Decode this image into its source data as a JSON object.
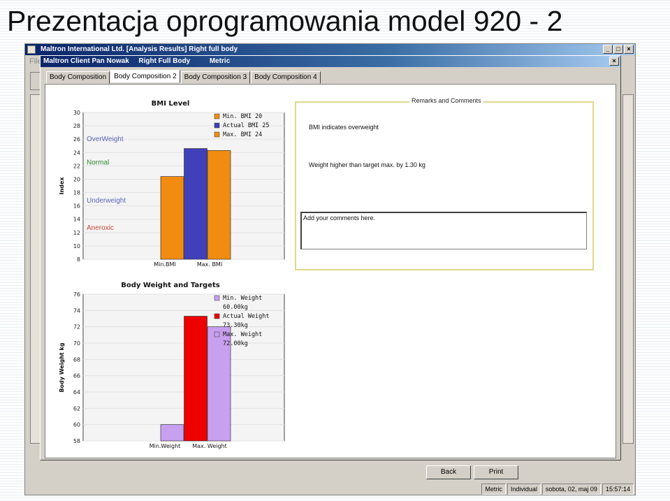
{
  "slide_title": "Prezentacja oprogramowania model 920 - 2",
  "outer_window": {
    "title": "Maltron International Ltd.  [Analysis Results]  Right full body",
    "menu_label": "File",
    "controls": [
      "_",
      "□",
      "×"
    ]
  },
  "inner_window": {
    "title_client": "Maltron Client Pan Nowak",
    "title_body": "Right Full Body",
    "title_unit": "Metric",
    "close": "×"
  },
  "tabs": [
    {
      "label": "Body Composition",
      "active": false
    },
    {
      "label": "Body Composition 2",
      "active": true
    },
    {
      "label": "Body Composition 3",
      "active": false
    },
    {
      "label": "Body Composition 4",
      "active": false
    }
  ],
  "chart_data": [
    {
      "type": "bar",
      "title": "BMI Level",
      "ylabel": "Index",
      "ylim": [
        8,
        30
      ],
      "yticks": [
        8,
        10,
        12,
        14,
        16,
        18,
        20,
        22,
        24,
        26,
        28,
        30
      ],
      "xtick_labels": [
        "Min.BMI",
        "Max. BMI"
      ],
      "bands": [
        {
          "label": "OverWeight",
          "y": 26,
          "color": "#5a66b8"
        },
        {
          "label": "Normal",
          "y": 22.5,
          "color": "#2e8a2e"
        },
        {
          "label": "Underweight",
          "y": 16.8,
          "color": "#5a66b8"
        },
        {
          "label": "Aneroxic",
          "y": 12.7,
          "color": "#cc4a3a"
        }
      ],
      "series": [
        {
          "name": "Min. BMI  20",
          "value": 20.4,
          "color": "#f28c10"
        },
        {
          "name": "Actual BMI  25",
          "value": 24.6,
          "color": "#4040bb"
        },
        {
          "name": "Max. BMI  24",
          "value": 24.3,
          "color": "#f28c10"
        }
      ]
    },
    {
      "type": "bar",
      "title": "Body Weight and Targets",
      "ylabel": "Body Weight kg",
      "ylim": [
        58,
        76
      ],
      "yticks": [
        58,
        60,
        62,
        64,
        66,
        68,
        70,
        72,
        74,
        76
      ],
      "xtick_labels": [
        "Min.Weight",
        "Max. Weight"
      ],
      "series": [
        {
          "name": "Min. Weight",
          "value_label": "60.00kg",
          "value": 60.0,
          "color": "#c8a0f0"
        },
        {
          "name": "Actual Weight",
          "value_label": "73.30kg",
          "value": 73.3,
          "color": "#ee0000"
        },
        {
          "name": "Max. Weight",
          "value_label": "72.00kg",
          "value": 72.0,
          "color": "#c8a0f0"
        }
      ]
    }
  ],
  "remarks": {
    "caption": "Remarks and Comments",
    "line1": "BMI indicates overweight",
    "line2": "Weight higher than target max. by  1.30  kg",
    "comments_placeholder": "Add your comments here."
  },
  "buttons": {
    "back": "Back",
    "print": "Print"
  },
  "status_bar": [
    "Metric",
    "Individual",
    "sobota, 02, maj 09",
    "15:57:14"
  ]
}
